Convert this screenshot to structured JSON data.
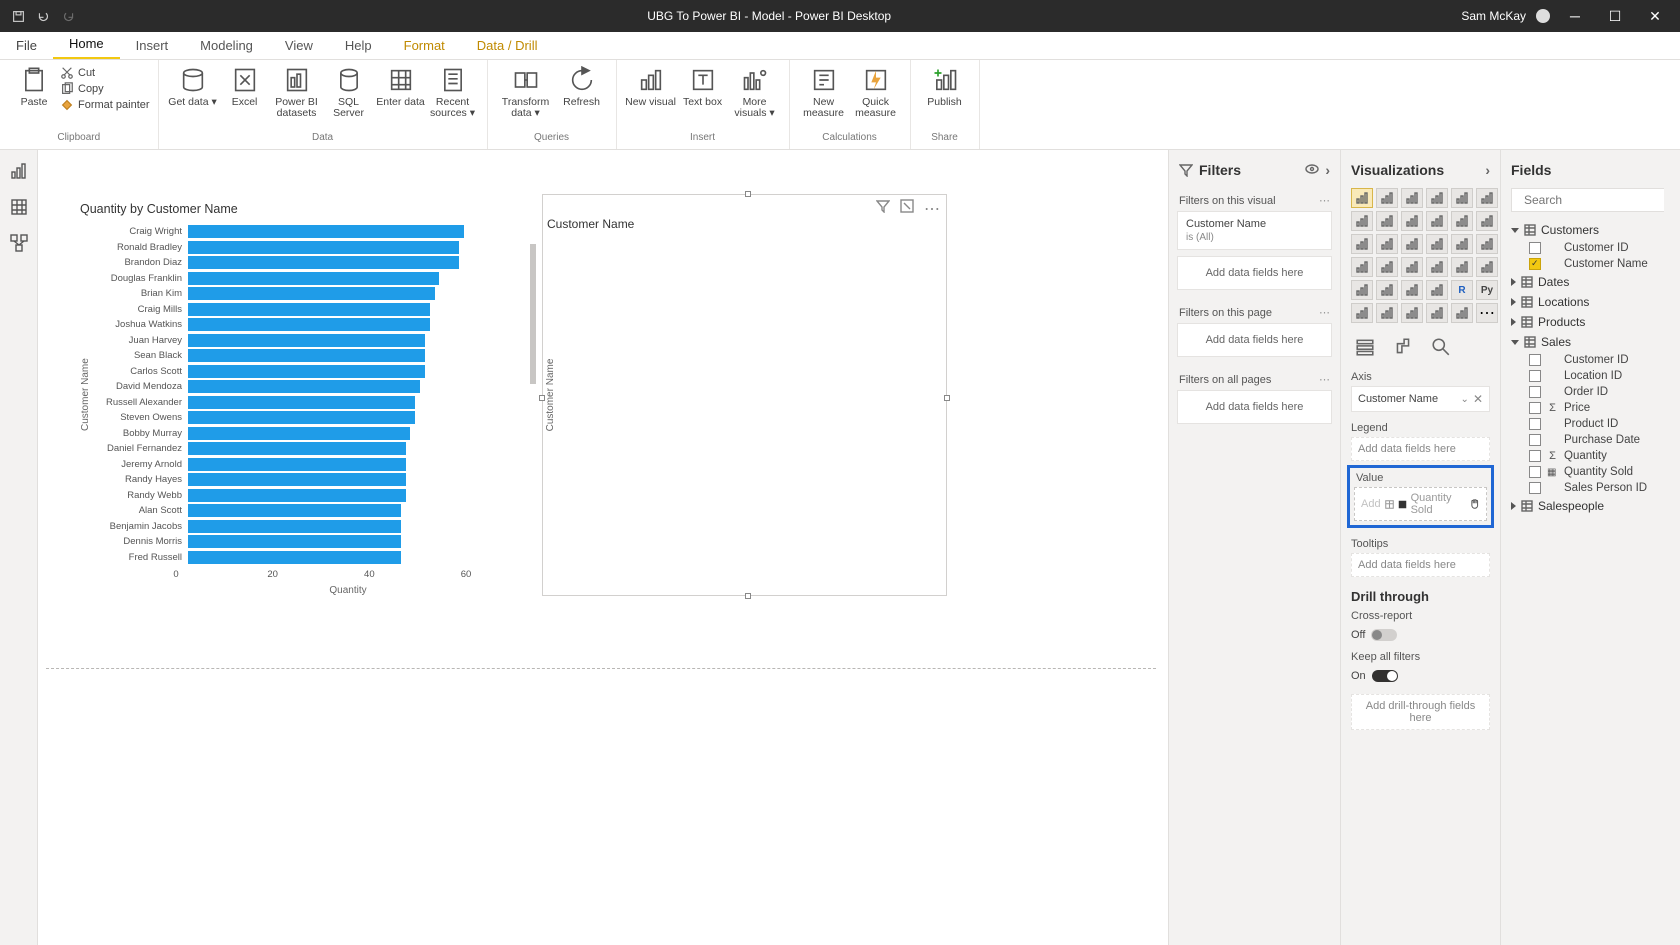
{
  "titlebar": {
    "title": "UBG To Power BI - Model - Power BI Desktop",
    "user": "Sam McKay"
  },
  "tabs": [
    "File",
    "Home",
    "Insert",
    "Modeling",
    "View",
    "Help",
    "Format",
    "Data / Drill"
  ],
  "ribbon": {
    "clipboard": {
      "label": "Clipboard",
      "paste": "Paste",
      "cut": "Cut",
      "copy": "Copy",
      "fmt": "Format painter"
    },
    "data": {
      "label": "Data",
      "get": "Get data",
      "excel": "Excel",
      "pbids": "Power BI datasets",
      "sql": "SQL Server",
      "enter": "Enter data",
      "recent": "Recent sources"
    },
    "queries": {
      "label": "Queries",
      "transform": "Transform data",
      "refresh": "Refresh"
    },
    "insert": {
      "label": "Insert",
      "visual": "New visual",
      "text": "Text box",
      "more": "More visuals"
    },
    "calc": {
      "label": "Calculations",
      "measure": "New measure",
      "quick": "Quick measure"
    },
    "share": {
      "label": "Share",
      "publish": "Publish"
    }
  },
  "filters": {
    "header": "Filters",
    "onVisual": "Filters on this visual",
    "cardName": "Customer Name",
    "cardSub": "is (All)",
    "dropVisual": "Add data fields here",
    "onPage": "Filters on this page",
    "dropPage": "Add data fields here",
    "onAll": "Filters on all pages",
    "dropAll": "Add data fields here"
  },
  "viz": {
    "header": "Visualizations",
    "axis": "Axis",
    "axisField": "Customer Name",
    "legend": "Legend",
    "legendDrop": "Add data fields here",
    "value": "Value",
    "valueDrop": "Add",
    "valueDragging": "Quantity Sold",
    "tooltips": "Tooltips",
    "tooltipsDrop": "Add data fields here",
    "drill": "Drill through",
    "cross": "Cross-report",
    "crossVal": "Off",
    "keep": "Keep all filters",
    "keepVal": "On",
    "drillDrop": "Add drill-through fields here"
  },
  "fields": {
    "header": "Fields",
    "search": "Search",
    "tables": [
      {
        "name": "Customers",
        "expanded": true,
        "fields": [
          {
            "name": "Customer ID",
            "checked": false
          },
          {
            "name": "Customer Name",
            "checked": true
          }
        ]
      },
      {
        "name": "Dates",
        "expanded": false
      },
      {
        "name": "Locations",
        "expanded": false
      },
      {
        "name": "Products",
        "expanded": false
      },
      {
        "name": "Sales",
        "expanded": true,
        "fields": [
          {
            "name": "Customer ID"
          },
          {
            "name": "Location ID"
          },
          {
            "name": "Order ID"
          },
          {
            "name": "Price",
            "sigma": true
          },
          {
            "name": "Product ID"
          },
          {
            "name": "Purchase Date"
          },
          {
            "name": "Quantity",
            "sigma": true
          },
          {
            "name": "Quantity Sold",
            "calc": true
          },
          {
            "name": "Sales Person ID"
          }
        ]
      },
      {
        "name": "Salespeople",
        "expanded": false
      }
    ]
  },
  "slicer": {
    "title": "Customer Name",
    "ylabel": "Customer Name"
  },
  "chart_data": {
    "type": "bar",
    "orientation": "horizontal",
    "title": "Quantity by Customer Name",
    "xlabel": "Quantity",
    "ylabel": "Customer Name",
    "xlim": [
      0,
      60
    ],
    "xticks": [
      0,
      20,
      40,
      60
    ],
    "categories": [
      "Craig Wright",
      "Ronald Bradley",
      "Brandon Diaz",
      "Douglas Franklin",
      "Brian Kim",
      "Craig Mills",
      "Joshua Watkins",
      "Juan Harvey",
      "Sean Black",
      "Carlos Scott",
      "David Mendoza",
      "Russell Alexander",
      "Steven Owens",
      "Bobby Murray",
      "Daniel Fernandez",
      "Jeremy Arnold",
      "Randy Hayes",
      "Randy Webb",
      "Alan Scott",
      "Benjamin Jacobs",
      "Dennis Morris",
      "Fred Russell"
    ],
    "values": [
      57,
      56,
      56,
      52,
      51,
      50,
      50,
      49,
      49,
      49,
      48,
      47,
      47,
      46,
      45,
      45,
      45,
      45,
      44,
      44,
      44,
      44
    ]
  }
}
